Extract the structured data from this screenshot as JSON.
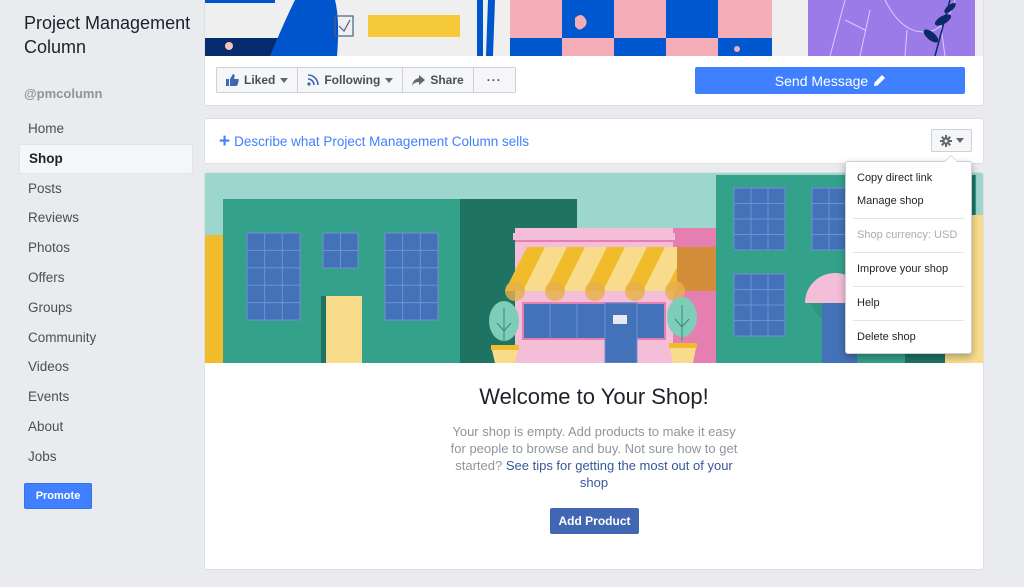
{
  "sidebar": {
    "page_name": "Project Management Column",
    "handle": "@pmcolumn",
    "nav_items": [
      {
        "label": "Home"
      },
      {
        "label": "Shop",
        "active": true
      },
      {
        "label": "Posts"
      },
      {
        "label": "Reviews"
      },
      {
        "label": "Photos"
      },
      {
        "label": "Offers"
      },
      {
        "label": "Groups"
      },
      {
        "label": "Community"
      },
      {
        "label": "Videos"
      },
      {
        "label": "Events"
      },
      {
        "label": "About"
      },
      {
        "label": "Jobs"
      }
    ],
    "promote_label": "Promote"
  },
  "cover": {
    "actions": {
      "liked": "Liked",
      "following": "Following",
      "share": "Share",
      "more": "···"
    },
    "send_message": "Send Message"
  },
  "describe": {
    "link_label": "Describe what Project Management Column sells"
  },
  "shop_menu": {
    "items": [
      {
        "label": "Copy direct link"
      },
      {
        "label": "Manage shop"
      },
      {
        "label": "Shop currency: USD",
        "disabled": true
      },
      {
        "label": "Improve your shop"
      },
      {
        "label": "Help"
      },
      {
        "label": "Delete shop"
      }
    ]
  },
  "shop": {
    "title": "Welcome to Your Shop!",
    "body": "Your shop is empty. Add products to make it easy for people to browse and buy. Not sure how to get started? ",
    "tips_link": "See tips for getting the most out of your shop",
    "add_product": "Add Product"
  },
  "colors": {
    "accent": "#4080ff",
    "button_dark": "#4267b2",
    "link": "#365899",
    "background": "#e9ebee"
  }
}
